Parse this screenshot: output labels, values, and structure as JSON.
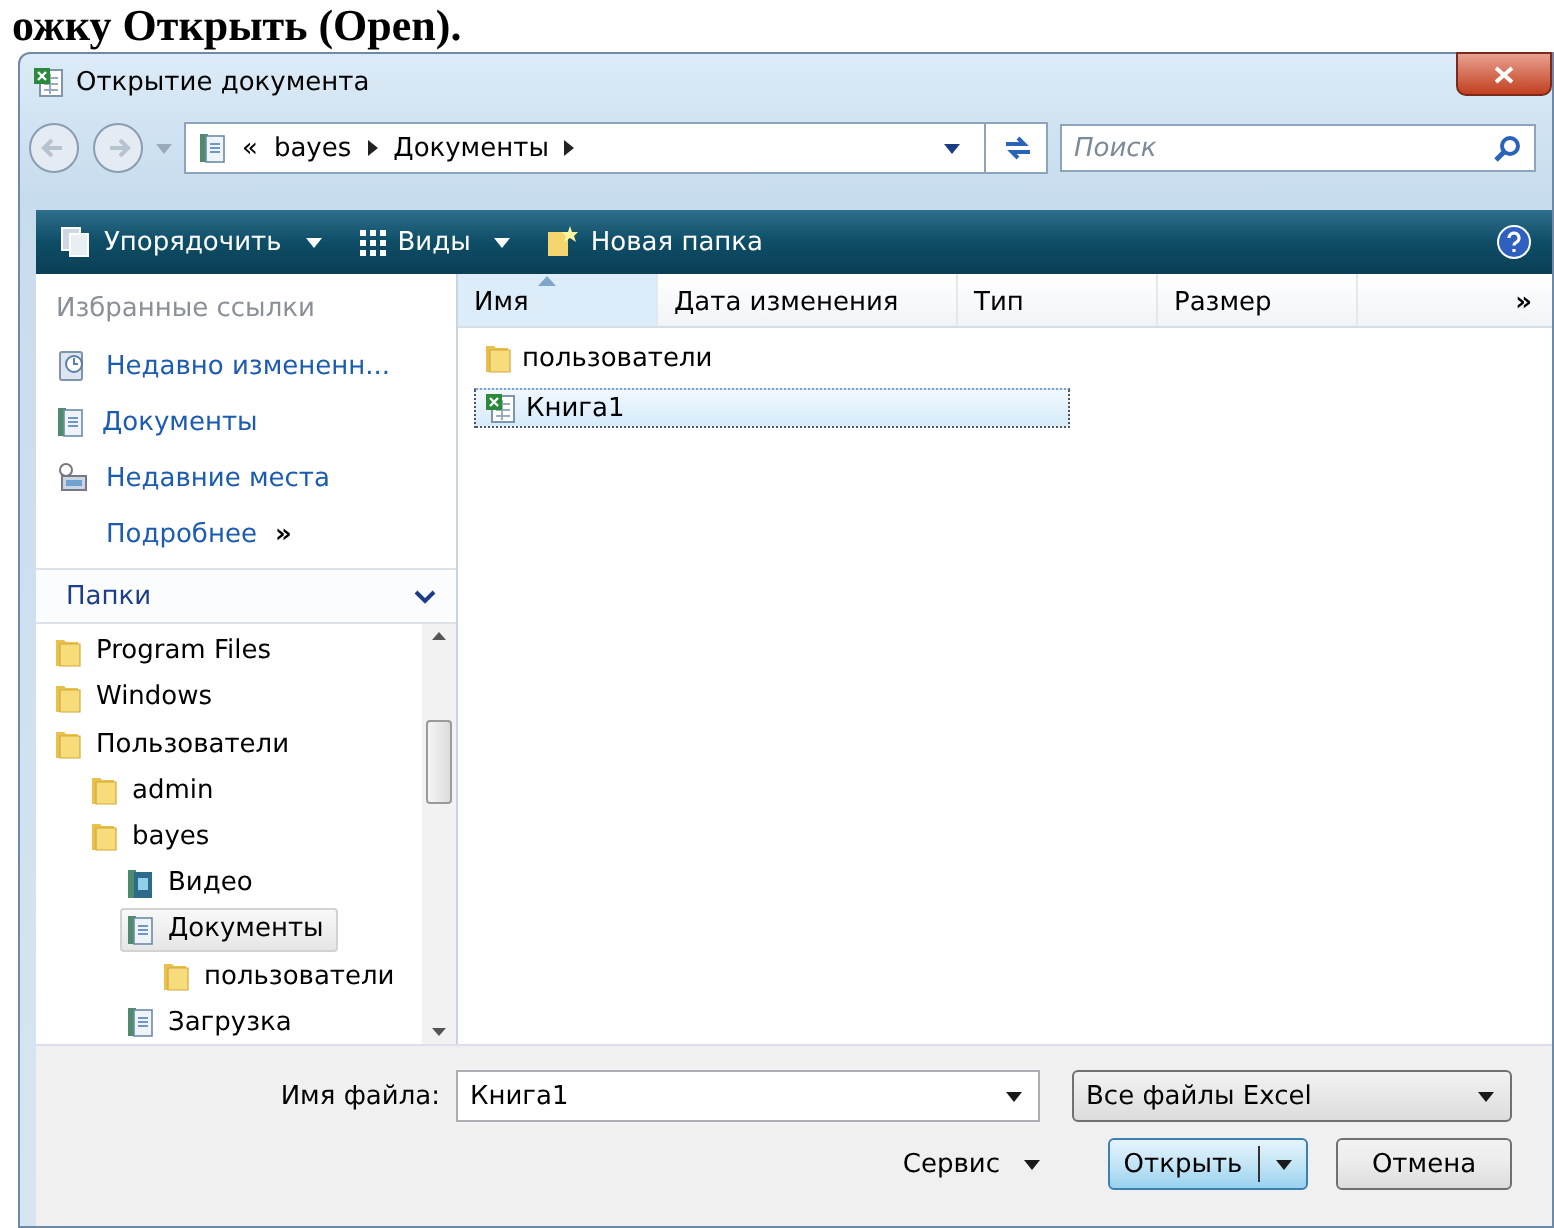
{
  "caption": "ожку Открыть (Open).",
  "window": {
    "title": "Открытие документа"
  },
  "address": {
    "overflow": "«",
    "crumbs": [
      "bayes",
      "Документы"
    ]
  },
  "search": {
    "placeholder": "Поиск"
  },
  "toolbar": [
    {
      "label": "Упорядочить",
      "kind": "dropdown"
    },
    {
      "label": "Виды",
      "kind": "dropdown"
    },
    {
      "label": "Новая папка",
      "kind": "button"
    }
  ],
  "favorites": {
    "title": "Избранные ссылки",
    "items": [
      {
        "label": "Недавно измененн...",
        "kind": "recent"
      },
      {
        "label": "Документы",
        "kind": "library"
      },
      {
        "label": "Недавние места",
        "kind": "places"
      }
    ],
    "more": "Подробнее",
    "more_glyph": "»"
  },
  "folders": {
    "title": "Папки",
    "tree": [
      {
        "label": "Program Files",
        "kind": "folder",
        "selected": false
      },
      {
        "label": "Windows",
        "kind": "folder",
        "selected": false
      },
      {
        "label": "Пользователи",
        "kind": "folder",
        "selected": false,
        "children": [
          {
            "label": "admin",
            "kind": "folder",
            "selected": false
          },
          {
            "label": "bayes",
            "kind": "folder",
            "selected": false,
            "children": [
              {
                "label": "Видео",
                "kind": "video",
                "selected": false
              },
              {
                "label": "Документы",
                "kind": "library",
                "selected": true,
                "children": [
                  {
                    "label": "пользователи",
                    "kind": "folder",
                    "selected": false
                  }
                ]
              },
              {
                "label": "Загрузка",
                "kind": "library",
                "selected": false
              }
            ]
          }
        ]
      }
    ]
  },
  "file_list": {
    "columns": [
      {
        "label": "Имя",
        "sorted": true
      },
      {
        "label": "Дата изменения",
        "sorted": false
      },
      {
        "label": "Тип",
        "sorted": false
      },
      {
        "label": "Размер",
        "sorted": false
      }
    ],
    "more": "»",
    "items": [
      {
        "name": "пользователи",
        "kind": "folder",
        "selected": false
      },
      {
        "name": "Книга1",
        "kind": "excel",
        "selected": true
      }
    ]
  },
  "bottom": {
    "filename_label": "Имя файла:",
    "filename": "Книга1",
    "filter": "Все файлы Excel",
    "tools": "Сервис",
    "open": "Открыть",
    "cancel": "Отмена"
  }
}
